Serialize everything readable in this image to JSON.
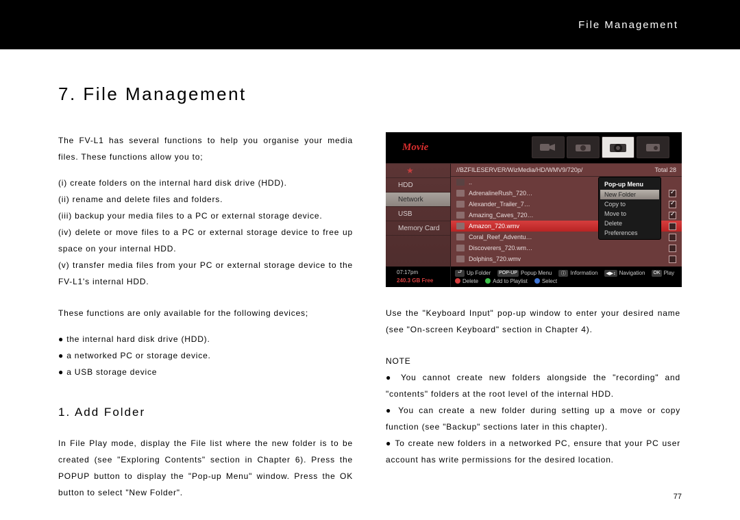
{
  "header": {
    "section_title": "File Management"
  },
  "chapter": {
    "title": "7. File Management"
  },
  "left": {
    "intro": "The FV-L1 has several functions to help you organise your media files. These functions allow you to;",
    "points": [
      "(i) create folders on the internal hard disk drive (HDD).",
      "(ii) rename and delete files and folders.",
      "(iii) backup your media files to a PC or external storage device.",
      "(iv) delete or move files to a PC or external storage device to free up space on your internal HDD.",
      "(v) transfer media files from your PC or external storage device to the FV-L1's internal HDD."
    ],
    "devices_intro": "These functions are only available for the following devices;",
    "devices": [
      "the internal hard disk drive (HDD).",
      "a networked PC or storage device.",
      "a USB storage device"
    ],
    "sub": {
      "title": "1. Add Folder"
    },
    "add_folder_para": "In File Play mode, display the File list where the new folder is to be created (see \"Exploring Contents\" section in Chapter 6).  Press the POPUP button to display the \"Pop-up Menu\" window.  Press the OK button to select \"New Folder\"."
  },
  "right": {
    "keyboard_para": "Use the \"Keyboard Input\" pop-up window to enter your desired name (see \"On-screen Keyboard\" section in Chapter 4).",
    "note_label": "NOTE",
    "notes": [
      "You cannot create new folders alongside the \"recording\" and \"contents\" folders at the root level of the internal HDD.",
      "You can create a new folder during setting up a move or copy function (see \"Backup\" sections later in this chapter).",
      "To create new folders in a networked PC, ensure that your PC user account has write permissions for the desired location."
    ]
  },
  "screenshot": {
    "category_label": "Movie",
    "sidebar": {
      "items": [
        "★",
        "HDD",
        "Network",
        "USB",
        "Memory Card"
      ],
      "selected_index": 2
    },
    "path": "//BZFILESERVER/WizMedia/HD/WMV9/720p/",
    "total_label": "Total 28",
    "files": [
      {
        "name": "..",
        "checked": false,
        "up": true
      },
      {
        "name": "AdrenalineRush_720…",
        "checked": true
      },
      {
        "name": "Alexander_Trailer_7…",
        "checked": true
      },
      {
        "name": "Amazing_Caves_720…",
        "checked": true
      },
      {
        "name": "Amazon_720.wmv",
        "checked": false,
        "selected": true
      },
      {
        "name": "Coral_Reef_Adventu…",
        "checked": false
      },
      {
        "name": "Discoverers_720.wm…",
        "checked": false
      },
      {
        "name": "Dolphins_720.wmv",
        "checked": false
      }
    ],
    "popup": {
      "title": "Pop-up Menu",
      "items": [
        "New Folder",
        "Copy to",
        "Move to",
        "Delete",
        "Preferences"
      ],
      "selected_index": 0
    },
    "status": {
      "time": "07:17pm",
      "free": "240.3 GB Free"
    },
    "hints": [
      {
        "key": "⮐",
        "label": "Up Folder"
      },
      {
        "key": "POP-UP",
        "label": "Popup Menu"
      },
      {
        "key": "ⓘ",
        "label": "Information"
      },
      {
        "key": "◀▶↕",
        "label": "Navigation"
      },
      {
        "key": "OK",
        "label": "Play"
      },
      {
        "key": "red",
        "label": "Delete"
      },
      {
        "key": "grn",
        "label": "Add to Playlist"
      },
      {
        "key": "blu",
        "label": "Select"
      }
    ]
  },
  "page_number": "77"
}
